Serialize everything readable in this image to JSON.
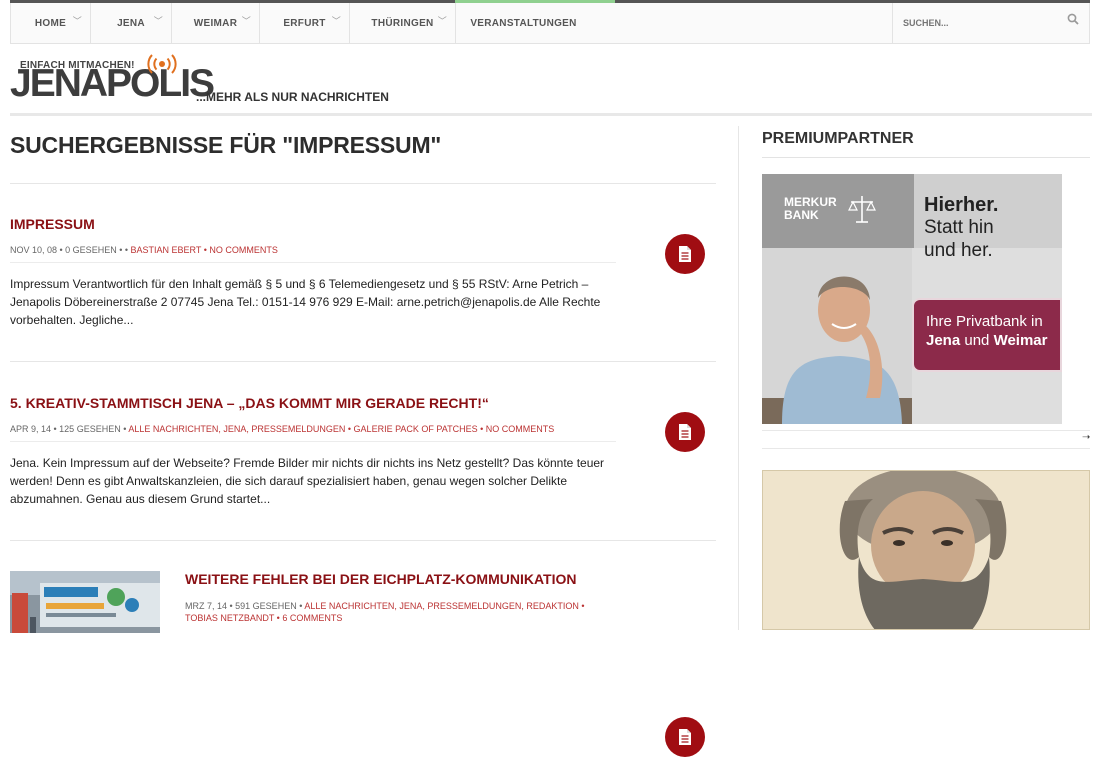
{
  "nav": {
    "items": [
      {
        "label": "HOME",
        "chevron": true
      },
      {
        "label": "JENA",
        "chevron": true
      },
      {
        "label": "WEIMAR",
        "chevron": true
      },
      {
        "label": "ERFURT",
        "chevron": true
      },
      {
        "label": "THÜRINGEN",
        "chevron": true
      },
      {
        "label": "VERANSTALTUNGEN",
        "chevron": false
      }
    ],
    "search_placeholder": "SUCHEN..."
  },
  "brand": {
    "slogan": "EINFACH MITMACHEN!",
    "name": "JENAPOLIS",
    "tagline": "...MEHR ALS NUR NACHRICHTEN"
  },
  "main": {
    "title": "SUCHERGEBNISSE FÜR \"IMPRESSUM\"",
    "posts": [
      {
        "title": "IMPRESSUM",
        "meta_plain": "NOV 10, 08 • 0 GESEHEN • • ",
        "meta_links": "BASTIAN EBERT • NO COMMENTS",
        "excerpt": "Impressum Verantwortlich für den Inhalt gemäß § 5 und § 6 Telemediengesetz und § 55 RStV: Arne Petrich – Jenapolis Döbereinerstraße 2 07745 Jena Tel.: 0151-14 976 929 E-Mail: arne.petrich@jenapolis.de Alle Rechte vorbehalten. Jegliche..."
      },
      {
        "title": "5. KREATIV-STAMMTISCH JENA – „DAS KOMMT MIR GERADE RECHT!“",
        "meta_plain": "APR 9, 14 • 125 GESEHEN • ",
        "meta_links": "ALLE NACHRICHTEN, JENA, PRESSEMELDUNGEN • GALERIE PACK OF PATCHES • NO COMMENTS",
        "excerpt": "Jena. Kein Impressum auf der Webseite? Fremde Bilder mir nichts dir nichts ins Netz gestellt? Das könnte teuer werden! Denn es gibt Anwaltskanzleien, die sich darauf spezialisiert haben, genau wegen solcher Delikte abzumahnen. Genau aus diesem Grund startet..."
      },
      {
        "title": "WEITERE FEHLER BEI DER EICHPLATZ-KOMMUNIKATION",
        "meta_plain": "MRZ 7, 14 • 591 GESEHEN • ",
        "meta_links_1": "ALLE NACHRICHTEN, JENA, PRESSEMELDUNGEN, REDAKTION •",
        "meta_links_2": "TOBIAS NETZBANDT • 6 COMMENTS"
      }
    ]
  },
  "sidebar": {
    "heading": "PREMIUMPARTNER",
    "ad": {
      "bank_name": "MERKUR BANK",
      "headline_1": "Hierher.",
      "headline_2": "Statt hin",
      "headline_3": "und her.",
      "box_line_1": "Ihre Privatbank in",
      "box_city_1": "Jena",
      "box_and": " und ",
      "box_city_2": "Weimar"
    },
    "arrow": "➝"
  },
  "colors": {
    "accent": "#8a1014",
    "button": "#a00d12",
    "logo_orange": "#e0701f"
  }
}
